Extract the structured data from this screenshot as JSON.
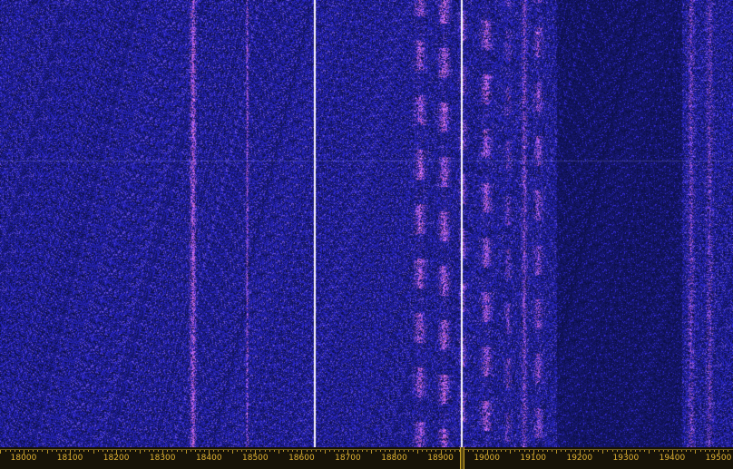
{
  "waterfall": {
    "freq_min": 17990,
    "freq_max": 19515,
    "background_color": "#0c1440",
    "noise_color": "#3a34d8",
    "signal_color": "#e48ae8",
    "carrier_color": "#ffffff",
    "signals": [
      {
        "freq": 18365,
        "width": 10,
        "intensity": 0.8,
        "type": "steady"
      },
      {
        "freq": 18482,
        "width": 3,
        "intensity": 0.7,
        "type": "steady"
      },
      {
        "freq": 18628,
        "width": 3,
        "intensity": 1.0,
        "type": "carrier"
      },
      {
        "freq": 18855,
        "width": 20,
        "intensity": 0.75,
        "type": "bursty"
      },
      {
        "freq": 18907,
        "width": 18,
        "intensity": 0.8,
        "type": "bursty"
      },
      {
        "freq": 18945,
        "width": 4,
        "intensity": 1.0,
        "type": "carrier"
      },
      {
        "freq": 18948,
        "width": 14,
        "intensity": 0.6,
        "type": "bursty"
      },
      {
        "freq": 18998,
        "width": 18,
        "intensity": 0.75,
        "type": "bursty"
      },
      {
        "freq": 19045,
        "width": 12,
        "intensity": 0.5,
        "type": "bursty"
      },
      {
        "freq": 19080,
        "width": 10,
        "intensity": 0.6,
        "type": "steady"
      },
      {
        "freq": 19110,
        "width": 16,
        "intensity": 0.65,
        "type": "bursty"
      },
      {
        "freq": 19440,
        "width": 12,
        "intensity": 0.55,
        "type": "steady"
      },
      {
        "freq": 19480,
        "width": 12,
        "intensity": 0.5,
        "type": "steady"
      }
    ],
    "quiet_band": {
      "from": 19150,
      "to": 19420
    }
  },
  "frequency_scale": {
    "labels": [
      "18000",
      "18100",
      "18200",
      "18300",
      "18400",
      "18500",
      "18600",
      "18700",
      "18800",
      "18900",
      "19000",
      "19100",
      "19200",
      "19300",
      "19400",
      "19500"
    ],
    "tune_marker_freq": 18945
  }
}
